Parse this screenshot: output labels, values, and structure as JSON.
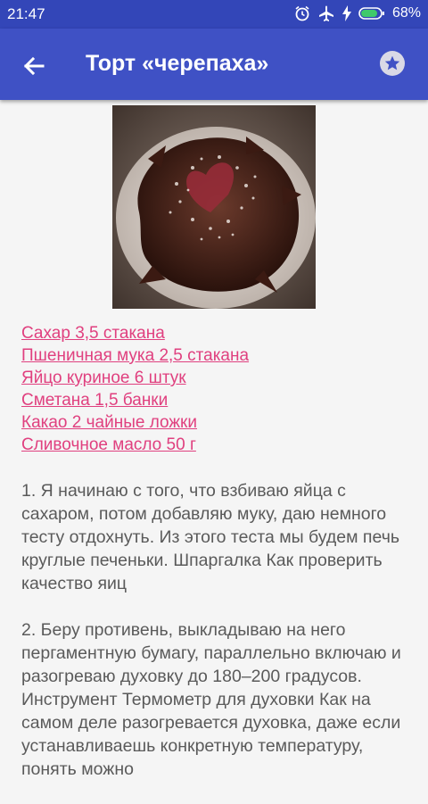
{
  "status_bar": {
    "time": "21:47",
    "battery": "68%"
  },
  "header": {
    "title": "Торт «черепаха»"
  },
  "icons": {
    "back": "arrow-back-icon",
    "favorite": "star-icon"
  },
  "colors": {
    "status_bar": "#3346b8",
    "app_bar": "#3f51c5",
    "link": "#e0407f"
  },
  "recipe": {
    "image_alt": "",
    "ingredients": [
      "Сахар 3,5 стакана",
      "Пшеничная мука 2,5 стакана",
      "Яйцо куриное 6 штук",
      "Сметана 1,5 банки",
      "Какао 2 чайные ложки",
      "Сливочное масло 50 г"
    ],
    "steps": [
      "1. Я начинаю с того, что взбиваю яйца с сахаром, потом добавляю муку, даю немного тесту отдохнуть. Из этого теста мы будем печь круглые печеньки. Шпаргалка Как проверить качество яиц",
      "2. Беру противень, выкладываю на него пергаментную бумагу, параллельно включаю и разогреваю духовку до 180–200 градусов. Инструмент Термометр для духовки Как на самом деле разогревается духовка, даже если устанавливаешь конкретную температуру, понять можно"
    ]
  }
}
